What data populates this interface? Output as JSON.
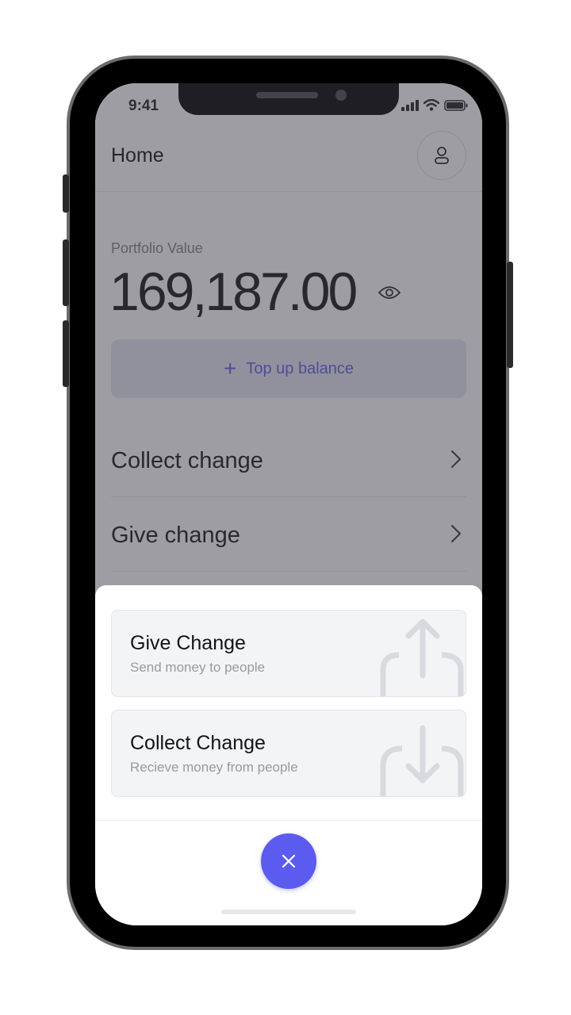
{
  "status_bar": {
    "time": "9:41"
  },
  "header": {
    "title": "Home",
    "avatar_icon": "user-icon"
  },
  "portfolio": {
    "label": "Portfolio Value",
    "value": "169,187.00",
    "visibility_icon": "eye-icon"
  },
  "topup": {
    "label": "Top up balance",
    "icon": "plus-icon"
  },
  "menu": [
    {
      "label": "Collect change",
      "icon": "chevron-right-icon"
    },
    {
      "label": "Give change",
      "icon": "chevron-right-icon"
    }
  ],
  "sheet": {
    "cards": [
      {
        "title": "Give Change",
        "subtitle": "Send money to people",
        "icon": "share-upload-icon"
      },
      {
        "title": "Collect Change",
        "subtitle": "Recieve money from people",
        "icon": "download-tray-icon"
      }
    ],
    "close_icon": "close-icon"
  },
  "colors": {
    "accent": "#5b5bf0",
    "topup_text": "#5f5fe6",
    "overlay": "rgba(60,60,72,0.50)"
  }
}
